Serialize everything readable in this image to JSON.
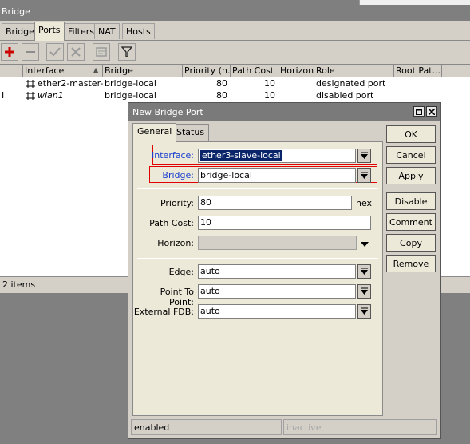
{
  "window": {
    "title": "Bridge",
    "tabs": [
      {
        "label": "Bridge"
      },
      {
        "label": "Ports"
      },
      {
        "label": "Filters"
      },
      {
        "label": "NAT"
      },
      {
        "label": "Hosts"
      }
    ],
    "active_tab": "Ports",
    "toolbar": [
      "add-icon",
      "remove-icon",
      "enable-icon",
      "disable-icon",
      "comment-icon",
      "filter-icon"
    ],
    "columns": [
      "Interface",
      "Bridge",
      "Priority (h...",
      "Path Cost",
      "Horizon",
      "Role",
      "Root Pat..."
    ],
    "rows": [
      {
        "flag": "",
        "interface": "ether2-master-l...",
        "bridge": "bridge-local",
        "priority": "80",
        "path_cost": "10",
        "horizon": "",
        "role": "designated port",
        "root_path": ""
      },
      {
        "flag": "I",
        "interface": "wlan1",
        "bridge": "bridge-local",
        "priority": "80",
        "path_cost": "10",
        "horizon": "",
        "role": "disabled port",
        "root_path": ""
      }
    ],
    "status": "2 items"
  },
  "dialog": {
    "title": "New Bridge Port",
    "tabs": [
      {
        "label": "General"
      },
      {
        "label": "Status"
      }
    ],
    "fields": {
      "interface": {
        "label": "Interface:",
        "value": "ether3-slave-local"
      },
      "bridge": {
        "label": "Bridge:",
        "value": "bridge-local"
      },
      "priority": {
        "label": "Priority:",
        "value": "80",
        "unit": "hex"
      },
      "path_cost": {
        "label": "Path Cost:",
        "value": "10"
      },
      "horizon": {
        "label": "Horizon:",
        "value": ""
      },
      "edge": {
        "label": "Edge:",
        "value": "auto"
      },
      "point_to_point": {
        "label": "Point To Point:",
        "value": "auto"
      },
      "external_fdb": {
        "label": "External FDB:",
        "value": "auto"
      }
    },
    "buttons": {
      "ok": "OK",
      "cancel": "Cancel",
      "apply": "Apply",
      "disable": "Disable",
      "comment": "Comment",
      "copy": "Copy",
      "remove": "Remove"
    },
    "status_left": "enabled",
    "status_right": "inactive"
  },
  "colors": {
    "highlight": "#0a246a",
    "label_blue": "#1a3fd0",
    "annotation_red": "#e00000"
  }
}
